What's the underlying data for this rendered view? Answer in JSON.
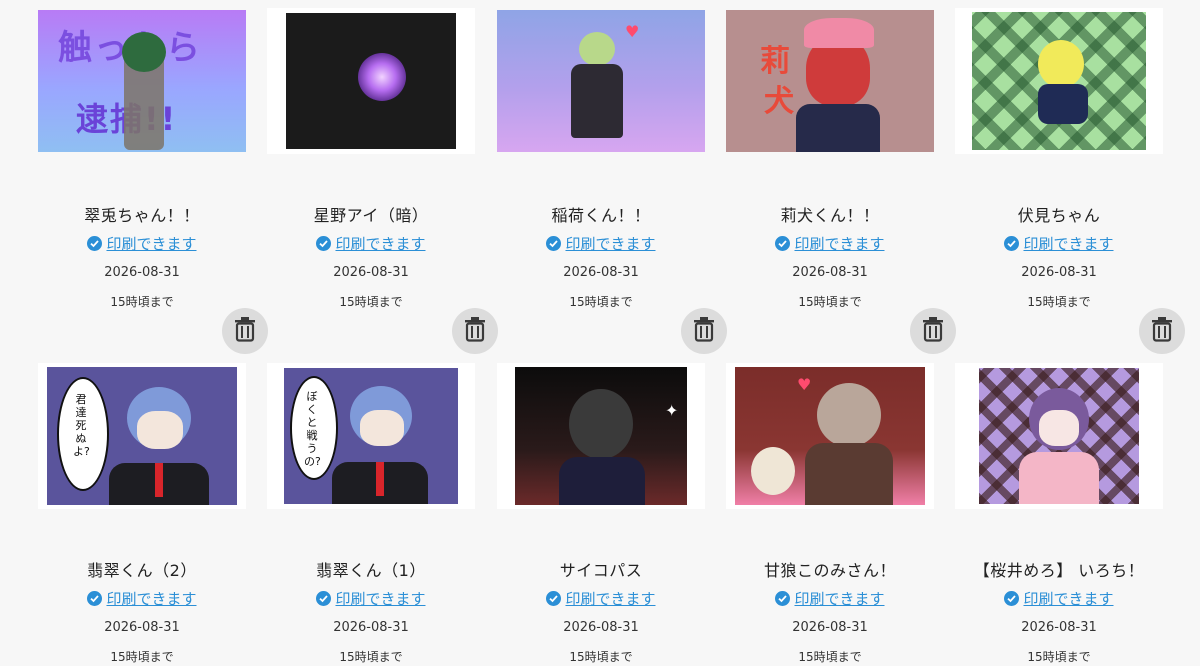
{
  "status_label": "印刷できます",
  "icons": {
    "status": "check-circle-icon",
    "delete": "trash-icon"
  },
  "colors": {
    "link": "#2b8fd6",
    "trash_bg": "#dcdcdc"
  },
  "rows": [
    {
      "items": [
        {
          "title": "翠兎ちゃん！！",
          "date": "2026-08-31",
          "until": "15時頃まで",
          "art_text": [
            "触ったら",
            "逮捕!!"
          ]
        },
        {
          "title": "星野アイ（暗）",
          "date": "2026-08-31",
          "until": "15時頃まで"
        },
        {
          "title": "稲荷くん！！",
          "date": "2026-08-31",
          "until": "15時頃まで"
        },
        {
          "title": "莉犬くん！！",
          "date": "2026-08-31",
          "until": "15時頃まで",
          "art_text": [
            "莉",
            "犬"
          ]
        },
        {
          "title": "伏見ちゃん",
          "date": "2026-08-31",
          "until": "15時頃まで"
        }
      ]
    },
    {
      "items": [
        {
          "title": "翡翠くん（2）",
          "date": "2026-08-31",
          "until": "15時頃まで",
          "art_text": [
            "君達死ぬよ?"
          ]
        },
        {
          "title": "翡翠くん（1）",
          "date": "2026-08-31",
          "until": "15時頃まで",
          "art_text": [
            "ぼくと戦うの?"
          ]
        },
        {
          "title": "サイコパス",
          "date": "2026-08-31",
          "until": "15時頃まで"
        },
        {
          "title": "甘狼このみさん！",
          "date": "2026-08-31",
          "until": "15時頃まで"
        },
        {
          "title": "【桜井めろ】 いろち！",
          "date": "2026-08-31",
          "until": "15時頃まで"
        }
      ]
    }
  ]
}
